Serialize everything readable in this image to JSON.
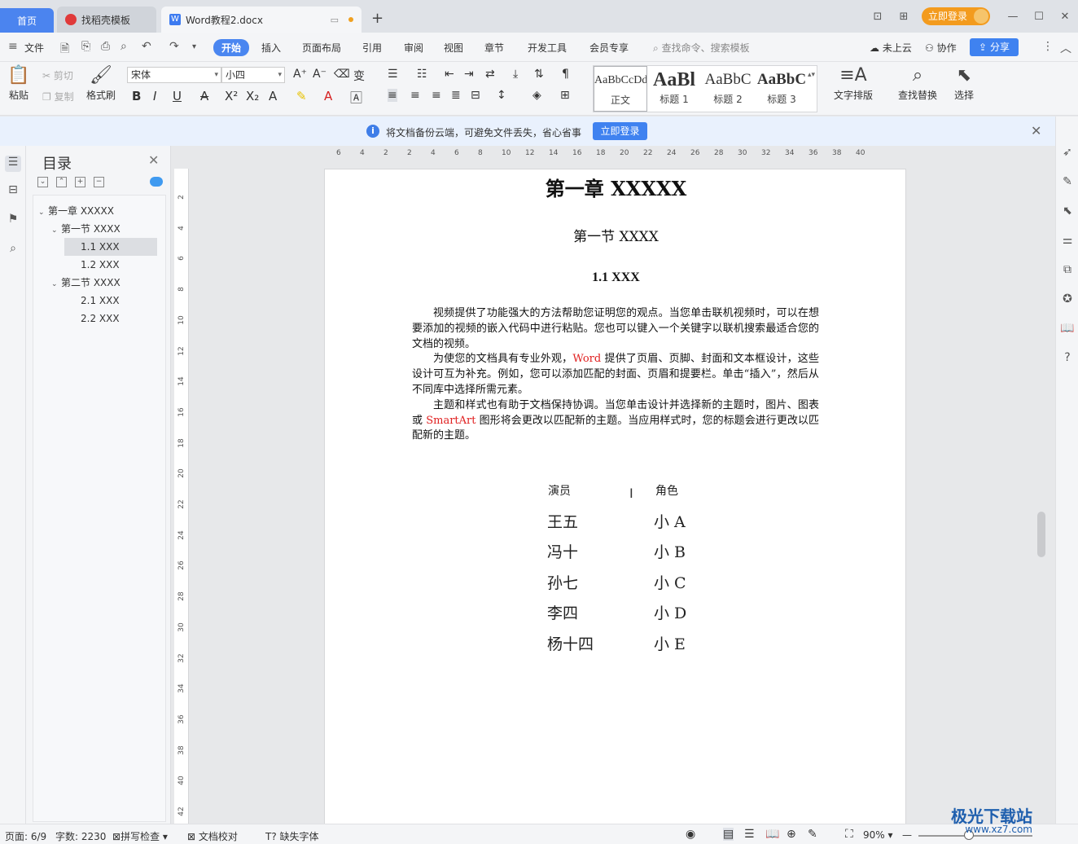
{
  "tabs": {
    "home": "首页",
    "find_template": "找稻壳模板",
    "document": "Word教程2.docx"
  },
  "titlebar": {
    "login": "立即登录"
  },
  "menu": {
    "file": "文件",
    "items": [
      "开始",
      "插入",
      "页面布局",
      "引用",
      "审阅",
      "视图",
      "章节",
      "开发工具",
      "会员专享"
    ],
    "search_placeholder": "查找命令、搜索模板",
    "cloud": "未上云",
    "collab": "协作",
    "share": "分享"
  },
  "ribbon": {
    "paste": "粘贴",
    "cut": "剪切",
    "copy": "复制",
    "format_painter": "格式刷",
    "font_name": "宋体",
    "font_size": "小四",
    "styles": [
      {
        "sample": "AaBbCcDd",
        "name": "正文"
      },
      {
        "sample": "AaBl",
        "name": "标题 1"
      },
      {
        "sample": "AaBbC",
        "name": "标题 2"
      },
      {
        "sample": "AaBbC",
        "name": "标题 3"
      }
    ],
    "text_layout": "文字排版",
    "find_replace": "查找替换",
    "select": "选择"
  },
  "notice": {
    "message": "将文档备份云端，可避免文件丢失，省心省事",
    "button": "立即登录"
  },
  "outline": {
    "title": "目录",
    "items": [
      {
        "label": "第一章 XXXXX",
        "level": 1,
        "expanded": true
      },
      {
        "label": "第一节 XXXX",
        "level": 2,
        "expanded": true
      },
      {
        "label": "1.1 XXX",
        "level": 3,
        "selected": true
      },
      {
        "label": "1.2 XXX",
        "level": 3
      },
      {
        "label": "第二节 XXXX",
        "level": 2,
        "expanded": true
      },
      {
        "label": "2.1 XXX",
        "level": 3
      },
      {
        "label": "2.2 XXX",
        "level": 3
      }
    ]
  },
  "ruler": {
    "h_ticks": [
      "6",
      "4",
      "2",
      "2",
      "4",
      "6",
      "8",
      "10",
      "12",
      "14",
      "16",
      "18",
      "20",
      "22",
      "24",
      "26",
      "28",
      "30",
      "32",
      "34",
      "36",
      "38",
      "40"
    ],
    "v_ticks": [
      "2",
      "4",
      "6",
      "8",
      "10",
      "12",
      "14",
      "16",
      "18",
      "20",
      "22",
      "24",
      "26",
      "28",
      "30",
      "32",
      "34",
      "36",
      "38",
      "40",
      "42"
    ]
  },
  "doc": {
    "chapter": "第一章  XXXXX",
    "section": "第一节  XXXX",
    "subsection": "1.1 XXX",
    "p1": "视频提供了功能强大的方法帮助您证明您的观点。当您单击联机视频时，可以在想要添加的视频的嵌入代码中进行粘贴。您也可以键入一个关键字以联机搜索最适合您的文档的视频。",
    "p2_a": "为使您的文档具有专业外观，",
    "p2_red": "Word",
    "p2_b": " 提供了页眉、页脚、封面和文本框设计，这些设计可互为补充。例如，您可以添加匹配的封面、页眉和提要栏。单击“插入”，然后从不同库中选择所需元素。",
    "p3_a": "主题和样式也有助于文档保持协调。当您单击设计并选择新的主题时，图片、图表或 ",
    "p3_red": "SmartArt",
    "p3_b": " 图形将会更改以匹配新的主题。当应用样式时，您的标题会进行更改以匹配新的主题。",
    "cast_headers": [
      "演员",
      "角色"
    ],
    "cast": [
      {
        "actor": "王五",
        "role": "小 A"
      },
      {
        "actor": "冯十",
        "role": "小 B"
      },
      {
        "actor": "孙七",
        "role": "小 C"
      },
      {
        "actor": "李四",
        "role": "小 D"
      },
      {
        "actor": "杨十四",
        "role": "小 E"
      }
    ]
  },
  "status": {
    "page": "页面: 6/9",
    "words": "字数: 2230",
    "spell": "拼写检查",
    "proof": "文档校对",
    "missing_font": "缺失字体",
    "zoom": "90%"
  },
  "watermark": {
    "name": "极光下载站",
    "url": "www.xz7.com"
  }
}
